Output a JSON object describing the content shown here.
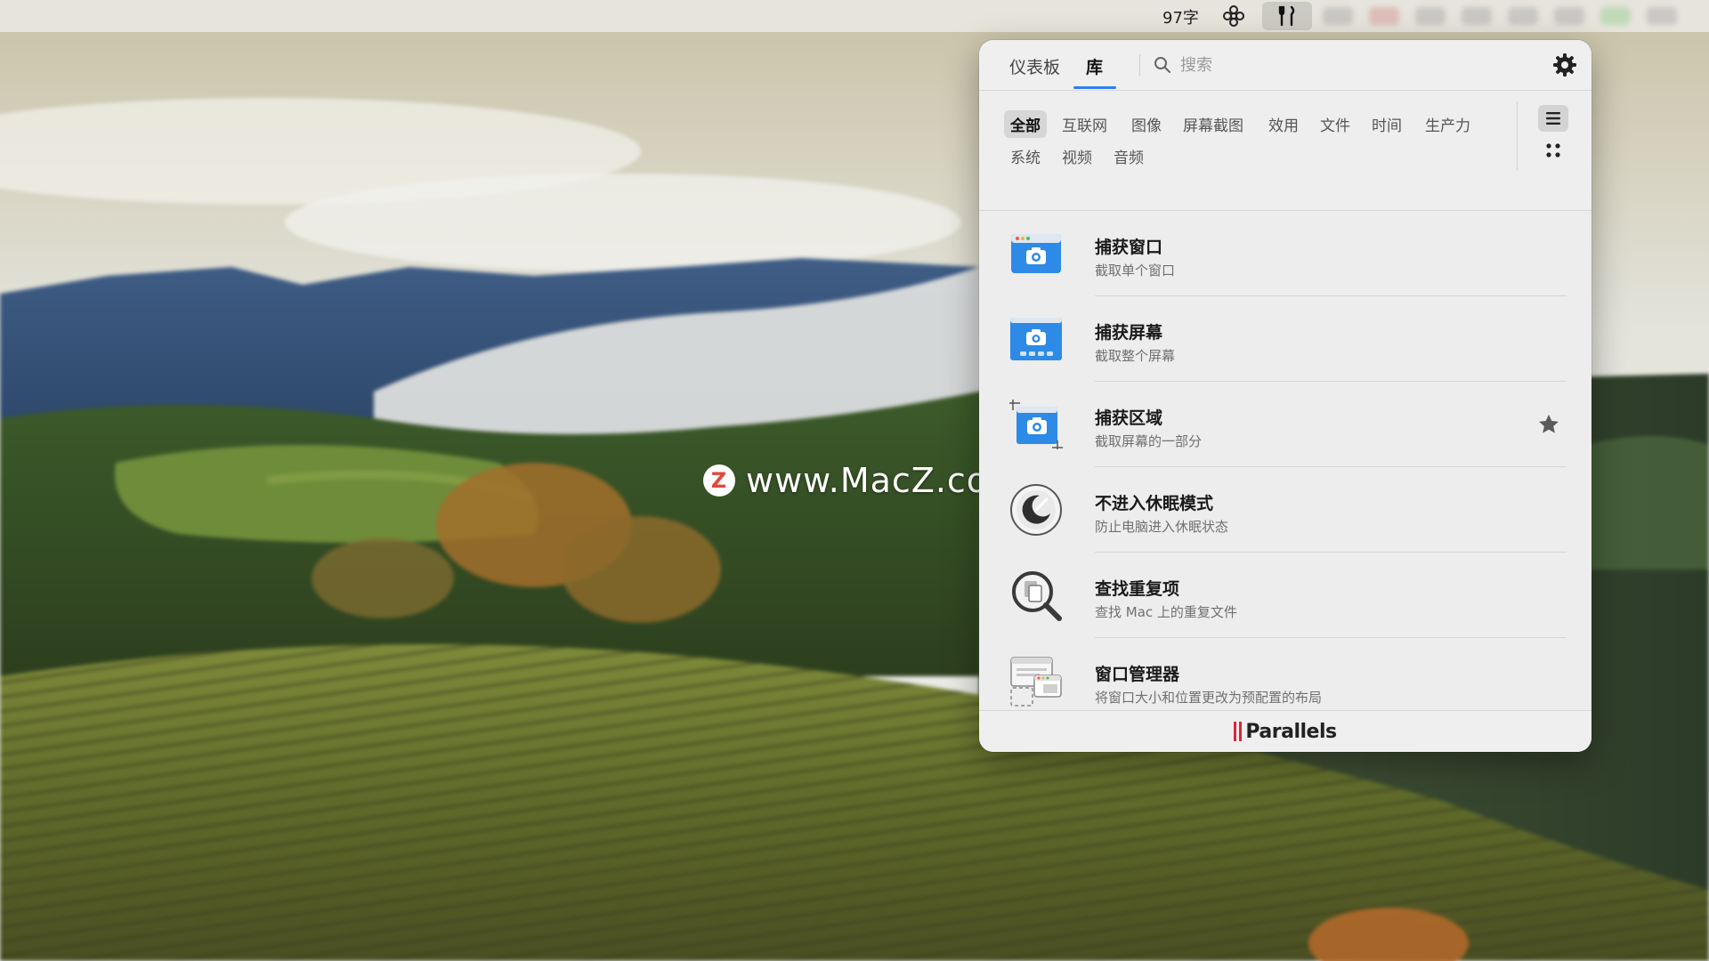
{
  "menubar": {
    "word_count": "97字",
    "icons": [
      "flower-icon",
      "tools-icon"
    ]
  },
  "watermark": {
    "logo": "Z",
    "text": "www.MacZ.com"
  },
  "panel": {
    "tabs": [
      {
        "label": "仪表板",
        "active": false
      },
      {
        "label": "库",
        "active": true
      }
    ],
    "search": {
      "placeholder": "搜索",
      "value": ""
    },
    "categories": [
      {
        "label": "全部",
        "active": true
      },
      {
        "label": "互联网",
        "active": false
      },
      {
        "label": "图像",
        "active": false
      },
      {
        "label": "屏幕截图",
        "active": false
      },
      {
        "label": "效用",
        "active": false
      },
      {
        "label": "文件",
        "active": false
      },
      {
        "label": "时间",
        "active": false
      },
      {
        "label": "生产力",
        "active": false
      },
      {
        "label": "系统",
        "active": false
      },
      {
        "label": "视频",
        "active": false
      },
      {
        "label": "音频",
        "active": false
      }
    ],
    "items": [
      {
        "title": "捕获窗口",
        "subtitle": "截取单个窗口",
        "icon": "capture-window-icon",
        "favorite": false
      },
      {
        "title": "捕获屏幕",
        "subtitle": "截取整个屏幕",
        "icon": "capture-screen-icon",
        "favorite": false
      },
      {
        "title": "捕获区域",
        "subtitle": "截取屏幕的一部分",
        "icon": "capture-area-icon",
        "favorite": true
      },
      {
        "title": "不进入休眠模式",
        "subtitle": "防止电脑进入休眠状态",
        "icon": "no-sleep-icon",
        "favorite": false
      },
      {
        "title": "查找重复项",
        "subtitle": "查找 Mac 上的重复文件",
        "icon": "find-duplicates-icon",
        "favorite": false
      },
      {
        "title": "窗口管理器",
        "subtitle": "将窗口大小和位置更改为预配置的布局",
        "icon": "window-manager-icon",
        "favorite": false
      }
    ],
    "footer_brand": "Parallels",
    "colors": {
      "accent": "#2f7ef3",
      "brand_red": "#d9263a",
      "camera_blue": "#2d8ae6"
    }
  }
}
